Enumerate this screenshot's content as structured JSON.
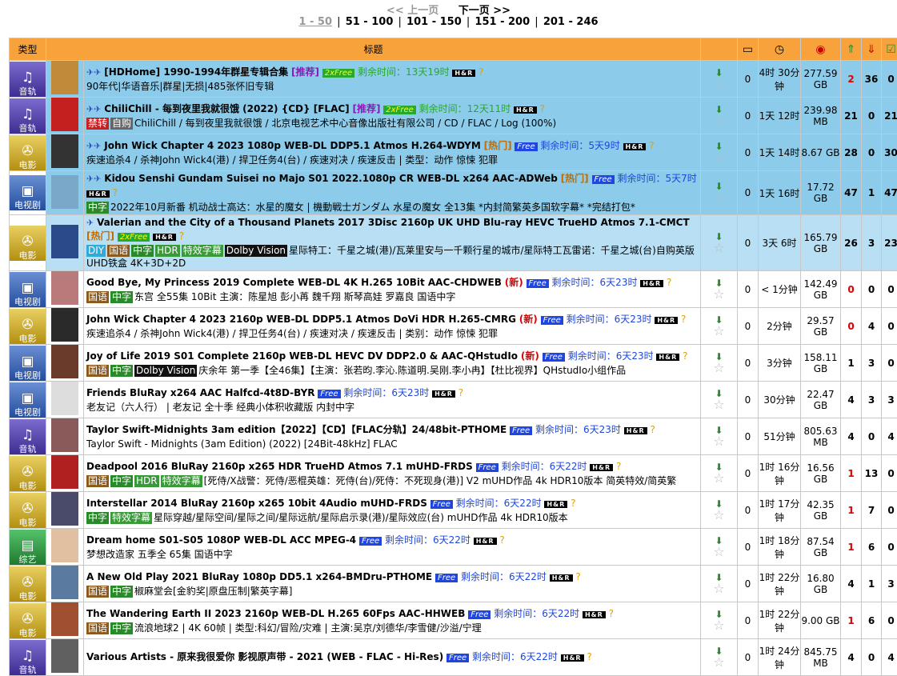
{
  "pager": {
    "prev": "<< 上一页",
    "next": "下一页 >>",
    "pages": [
      "1 - 50",
      "51 - 100",
      "101 - 150",
      "151 - 200",
      "201 - 246"
    ]
  },
  "header": {
    "type": "类型",
    "title": "标题"
  },
  "rows": [
    {
      "cat": "音轨",
      "cat_class": "c-music",
      "hl": "hl",
      "stars": "✈✈",
      "name": "[HDHome] 1990-1994年群星专辑合集",
      "tag": "[推荐]",
      "tag_class": "tag-rec",
      "free": "2xFree",
      "free_class": "free2x",
      "remain": "剩余时间：13天19时",
      "remain_class": "remain2",
      "sub": "90年代|华语音乐|群星|无损|485张怀旧专辑",
      "badges": [],
      "comments": "0",
      "time": "4时 30分钟",
      "size": "277.59 GB",
      "up": "2",
      "down": "36",
      "fin": "0",
      "up_red": true
    },
    {
      "cat": "音轨",
      "cat_class": "c-music",
      "hl": "hl",
      "stars": "✈✈",
      "name": "ChiliChill - 每到夜里我就很饿 (2022) {CD} [FLAC]",
      "tag": "[推荐]",
      "tag_class": "tag-rec",
      "free": "2xFree",
      "free_class": "free2x",
      "remain": "剩余时间：12天11时",
      "remain_class": "remain2",
      "sub": "ChiliChill / 每到夜里我就很饿 / 北京电视艺术中心音像出版社有限公司 / CD / FLAC / Log (100%)",
      "badges": [
        [
          "禁转",
          "t-jz"
        ],
        [
          "自购",
          "t-zc"
        ]
      ],
      "comments": "0",
      "time": "1天 12时",
      "size": "239.98 MB",
      "up": "21",
      "down": "0",
      "fin": "21",
      "up_red": false
    },
    {
      "cat": "电影",
      "cat_class": "c-movie",
      "hl": "hl",
      "stars": "✈✈",
      "name": "John Wick Chapter 4 2023 1080p WEB-DL DDP5.1 Atmos H.264-WDYM",
      "tag": "[热门]",
      "tag_class": "tag-hot",
      "free": "Free",
      "free_class": "free",
      "remain": "剩余时间：5天9时",
      "remain_class": "remain",
      "sub": "疾速追杀4 / 杀神John Wick4(港) / 捍卫任务4(台) / 疾速对决 / 疾速反击 | 类型：动作 惊悚 犯罪",
      "badges": [],
      "comments": "0",
      "time": "1天 14时",
      "size": "8.67 GB",
      "up": "28",
      "down": "0",
      "fin": "30",
      "up_red": false
    },
    {
      "cat": "电视剧",
      "cat_class": "c-tv",
      "hl": "hl",
      "stars": "✈✈",
      "name": "Kidou Senshi Gundam Suisei no Majo S01 2022.1080p CR WEB-DL x264 AAC-ADWeb",
      "tag": "[热门]",
      "tag_class": "tag-hot",
      "free": "Free",
      "free_class": "free",
      "remain": "剩余时间：5天7时",
      "remain_class": "remain",
      "sub": "2022年10月新番 机动战士高达：水星的魔女 | 機動戦士ガンダム 水星の魔女 全13集 *内封简繁英多国软字幕* *完结打包*",
      "badges": [
        [
          "中字",
          "t-zz"
        ]
      ],
      "comments": "0",
      "time": "1天 16时",
      "size": "17.72 GB",
      "up": "47",
      "down": "1",
      "fin": "47",
      "up_red": false
    },
    {
      "cat": "电影",
      "cat_class": "c-movie",
      "hl": "hl2",
      "stars": "✈",
      "name": "Valerian and the City of a Thousand Planets 2017 3Disc 2160p UK UHD Blu-ray HEVC TrueHD Atmos 7.1-CMCT",
      "tag": "[热门]",
      "tag_class": "tag-hot",
      "free": "2xFree",
      "free_class": "free2x",
      "remain": "",
      "remain_class": "remain2",
      "sub": "星际特工：千星之城(港)/瓦莱里安与一千颗行星的城市/星际特工瓦雷诺：千星之城(台)自购英版UHD铁盒 4K+3D+2D",
      "badges": [
        [
          "DIY",
          "t-diy"
        ],
        [
          "国语",
          "t-gy"
        ],
        [
          "中字",
          "t-zz"
        ],
        [
          "HDR",
          "t-hdr"
        ],
        [
          "特效字幕",
          "t-tx"
        ],
        [
          "Dolby Vision",
          "t-dv"
        ]
      ],
      "comments": "0",
      "time": "3天 6时",
      "size": "165.79 GB",
      "up": "26",
      "down": "3",
      "fin": "23",
      "up_red": false
    },
    {
      "cat": "电视剧",
      "cat_class": "c-tv",
      "hl": "",
      "stars": "",
      "name": "Good Bye, My Princess 2019 Complete WEB-DL 4K H.265 10Bit AAC-CHDWEB",
      "tag": "(新)",
      "tag_class": "tag-new",
      "free": "Free",
      "free_class": "free",
      "remain": "剩余时间：6天23时",
      "remain_class": "remain",
      "sub": "东宫 全55集 10Bit 主演：陈星旭 彭小苒 魏千翔 斯琴高娃 罗嘉良 国语中字",
      "badges": [
        [
          "国语",
          "t-gy"
        ],
        [
          "中字",
          "t-zz"
        ]
      ],
      "comments": "0",
      "time": "< 1分钟",
      "size": "142.49 GB",
      "up": "0",
      "down": "0",
      "fin": "0",
      "up_red": true
    },
    {
      "cat": "电影",
      "cat_class": "c-movie",
      "hl": "",
      "stars": "",
      "name": "John Wick Chapter 4 2023 2160p WEB-DL DDP5.1 Atmos DoVi HDR H.265-CMRG",
      "tag": "(新)",
      "tag_class": "tag-new",
      "free": "Free",
      "free_class": "free",
      "remain": "剩余时间：6天23时",
      "remain_class": "remain",
      "sub": "疾速追杀4 / 杀神John Wick4(港) / 捍卫任务4(台) / 疾速对决 / 疾速反击 | 类别：动作 惊悚 犯罪",
      "badges": [],
      "comments": "0",
      "time": "2分钟",
      "size": "29.57 GB",
      "up": "0",
      "down": "4",
      "fin": "0",
      "up_red": true
    },
    {
      "cat": "电视剧",
      "cat_class": "c-tv",
      "hl": "",
      "stars": "",
      "name": "Joy of Life 2019 S01 Complete 2160p WEB-DL HEVC DV DDP2.0 & AAC-QHstudIo",
      "tag": "(新)",
      "tag_class": "tag-new",
      "free": "Free",
      "free_class": "free",
      "remain": "剩余时间：6天23时",
      "remain_class": "remain",
      "sub": "庆余年 第一季【全46集】【主演：张若昀.李沁.陈道明.吴刚.李小冉】【杜比视界】QHstudIo小组作品",
      "badges": [
        [
          "国语",
          "t-gy"
        ],
        [
          "中字",
          "t-zz"
        ],
        [
          "Dolby Vision",
          "t-dv"
        ]
      ],
      "comments": "0",
      "time": "3分钟",
      "size": "158.11 GB",
      "up": "1",
      "down": "3",
      "fin": "0",
      "up_red": false
    },
    {
      "cat": "电视剧",
      "cat_class": "c-tv",
      "hl": "",
      "stars": "",
      "name": "Friends BluRay x264 AAC Halfcd-4t8D-BYR",
      "tag": "",
      "tag_class": "",
      "free": "Free",
      "free_class": "free",
      "remain": "剩余时间：6天23时",
      "remain_class": "remain",
      "sub": "老友记（六人行） | 老友记 全十季 经典小体积收藏版 内封中字",
      "badges": [],
      "comments": "0",
      "time": "30分钟",
      "size": "22.47 GB",
      "up": "4",
      "down": "3",
      "fin": "3",
      "up_red": false
    },
    {
      "cat": "音轨",
      "cat_class": "c-music",
      "hl": "",
      "stars": "",
      "name": "Taylor Swift-Midnights 3am edition【2022】【CD】【FLAC分轨】24/48bit-PTHOME",
      "tag": "",
      "tag_class": "",
      "free": "Free",
      "free_class": "free",
      "remain": "剩余时间：6天23时",
      "remain_class": "remain",
      "sub": "Taylor Swift - Midnights (3am Edition) (2022) [24Bit-48kHz] FLAC",
      "badges": [],
      "comments": "0",
      "time": "51分钟",
      "size": "805.63 MB",
      "up": "4",
      "down": "0",
      "fin": "4",
      "up_red": false
    },
    {
      "cat": "电影",
      "cat_class": "c-movie",
      "hl": "",
      "stars": "",
      "name": "Deadpool 2016 BluRay 2160p x265 HDR TrueHD Atmos 7.1 mUHD-FRDS",
      "tag": "",
      "tag_class": "",
      "free": "Free",
      "free_class": "free",
      "remain": "剩余时间：6天22时",
      "remain_class": "remain",
      "sub": "[死侍/X战警：死侍/恶棍英雄：死侍(台)/死侍：不死现身(港)] V2 mUHD作品 4k HDR10版本 简英特效/简英繁",
      "badges": [
        [
          "国语",
          "t-gy"
        ],
        [
          "中字",
          "t-zz"
        ],
        [
          "HDR",
          "t-hdr"
        ],
        [
          "特效字幕",
          "t-tx"
        ]
      ],
      "comments": "0",
      "time": "1时 16分钟",
      "size": "16.56 GB",
      "up": "1",
      "down": "13",
      "fin": "0",
      "up_red": true
    },
    {
      "cat": "电影",
      "cat_class": "c-movie",
      "hl": "",
      "stars": "",
      "name": "Interstellar 2014 BluRay 2160p x265 10bit 4Audio mUHD-FRDS",
      "tag": "",
      "tag_class": "",
      "free": "Free",
      "free_class": "free",
      "remain": "剩余时间：6天22时",
      "remain_class": "remain",
      "sub": "星际穿越/星际空间/星际之间/星际远航/星际启示录(港)/星际效应(台) mUHD作品 4k HDR10版本",
      "badges": [
        [
          "中字",
          "t-zz"
        ],
        [
          "特效字幕",
          "t-tx"
        ]
      ],
      "comments": "0",
      "time": "1时 17分钟",
      "size": "42.35 GB",
      "up": "1",
      "down": "7",
      "fin": "0",
      "up_red": true
    },
    {
      "cat": "综艺",
      "cat_class": "c-var",
      "hl": "",
      "stars": "",
      "name": "Dream home S01-S05 1080P WEB-DL ACC MPEG-4",
      "tag": "",
      "tag_class": "",
      "free": "Free",
      "free_class": "free",
      "remain": "剩余时间：6天22时",
      "remain_class": "remain",
      "sub": "梦想改造家 五季全 65集 国语中字",
      "badges": [],
      "comments": "0",
      "time": "1时 18分钟",
      "size": "87.54 GB",
      "up": "1",
      "down": "6",
      "fin": "0",
      "up_red": true
    },
    {
      "cat": "电影",
      "cat_class": "c-movie",
      "hl": "",
      "stars": "",
      "name": "A New Old Play 2021 BluRay 1080p DD5.1 x264-BMDru-PTHOME",
      "tag": "",
      "tag_class": "",
      "free": "Free",
      "free_class": "free",
      "remain": "剩余时间：6天22时",
      "remain_class": "remain",
      "sub": "椒麻堂会[金豹奖|原盘压制|繁英字幕]",
      "badges": [
        [
          "国语",
          "t-gy"
        ],
        [
          "中字",
          "t-zz"
        ]
      ],
      "comments": "0",
      "time": "1时 22分钟",
      "size": "16.80 GB",
      "up": "4",
      "down": "1",
      "fin": "3",
      "up_red": false
    },
    {
      "cat": "电影",
      "cat_class": "c-movie",
      "hl": "",
      "stars": "",
      "name": "The Wandering Earth II 2023 2160p WEB-DL H.265 60Fps AAC-HHWEB",
      "tag": "",
      "tag_class": "",
      "free": "Free",
      "free_class": "free",
      "remain": "剩余时间：6天22时",
      "remain_class": "remain",
      "sub": "流浪地球2 | 4K 60帧 | 类型:科幻/冒险/灾难 | 主演:吴京/刘德华/李雪健/沙溢/宁理",
      "badges": [
        [
          "国语",
          "t-gy"
        ],
        [
          "中字",
          "t-zz"
        ]
      ],
      "comments": "0",
      "time": "1时 22分钟",
      "size": "9.00 GB",
      "up": "1",
      "down": "6",
      "fin": "0",
      "up_red": true
    },
    {
      "cat": "音轨",
      "cat_class": "c-music",
      "hl": "",
      "stars": "",
      "name": "Various Artists - 原来我很爱你 影视原声带 - 2021 (WEB - FLAC - Hi-Res)",
      "tag": "",
      "tag_class": "",
      "free": "Free",
      "free_class": "free",
      "remain": "剩余时间：6天22时",
      "remain_class": "remain",
      "sub": "",
      "badges": [],
      "comments": "0",
      "time": "1时 24分钟",
      "size": "845.75 MB",
      "up": "4",
      "down": "0",
      "fin": "4",
      "up_red": false
    }
  ],
  "colors": {
    "header": "#f7a23a",
    "highlight": "#8ccbe9",
    "free": "#1f46e0",
    "free2x": "#29a82f"
  }
}
